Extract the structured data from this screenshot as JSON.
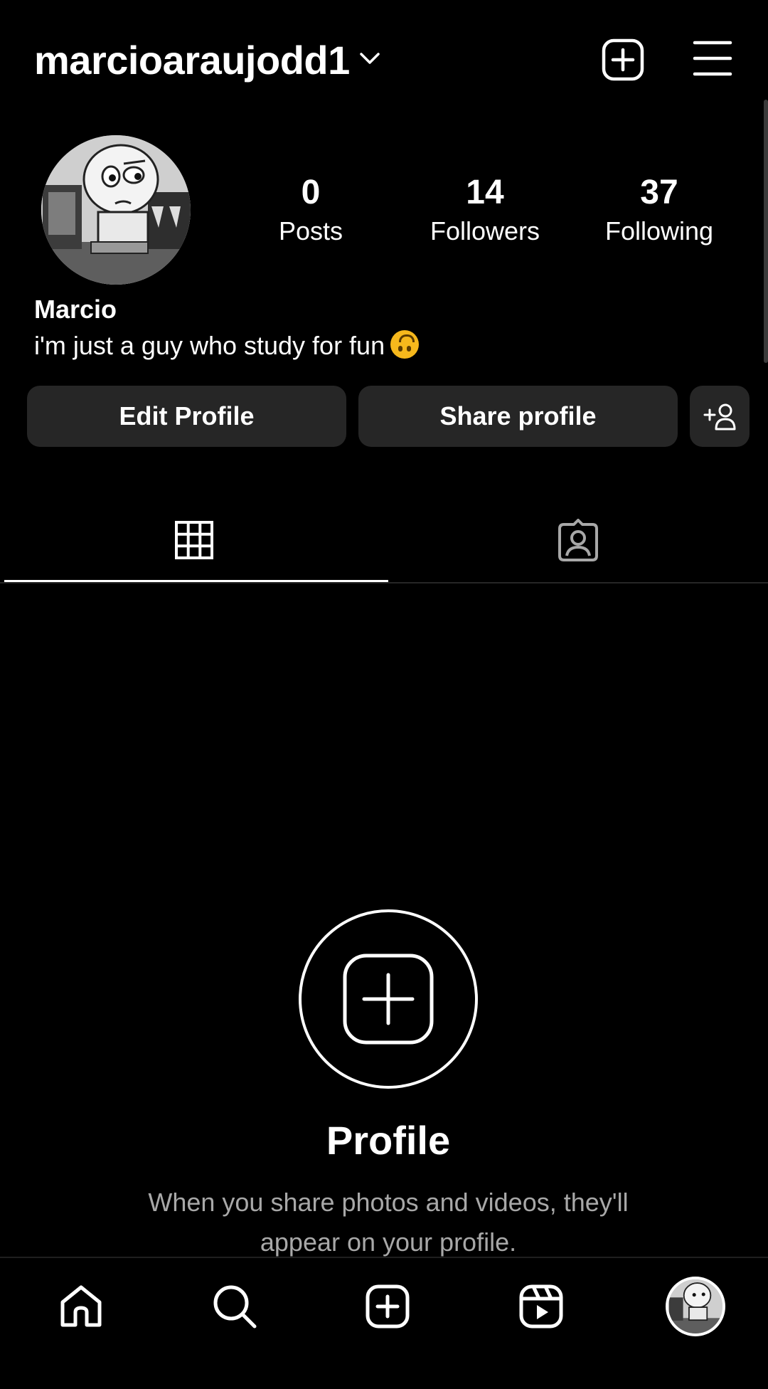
{
  "header": {
    "username": "marcioaraujodd1"
  },
  "stats": {
    "posts": {
      "value": "0",
      "label": "Posts"
    },
    "followers": {
      "value": "14",
      "label": "Followers"
    },
    "following": {
      "value": "37",
      "label": "Following"
    }
  },
  "profile": {
    "display_name": "Marcio",
    "bio": "i'm just a guy who study for fun"
  },
  "buttons": {
    "edit_profile": "Edit Profile",
    "share_profile": "Share profile"
  },
  "empty_state": {
    "title": "Profile",
    "text": "When you share photos and videos, they'll appear on your profile."
  },
  "icons": {
    "chevron": "chevron-down-icon",
    "new_post": "plus-square-icon",
    "menu": "hamburger-menu-icon",
    "discover": "add-person-icon",
    "grid": "grid-icon",
    "tagged": "tagged-portrait-icon",
    "home": "home-icon",
    "search": "search-icon",
    "create": "create-icon",
    "reels": "reels-icon"
  },
  "colors": {
    "background": "#000000",
    "button_bg": "#262626",
    "secondary_text": "#a8a8a8",
    "text": "#ffffff"
  }
}
